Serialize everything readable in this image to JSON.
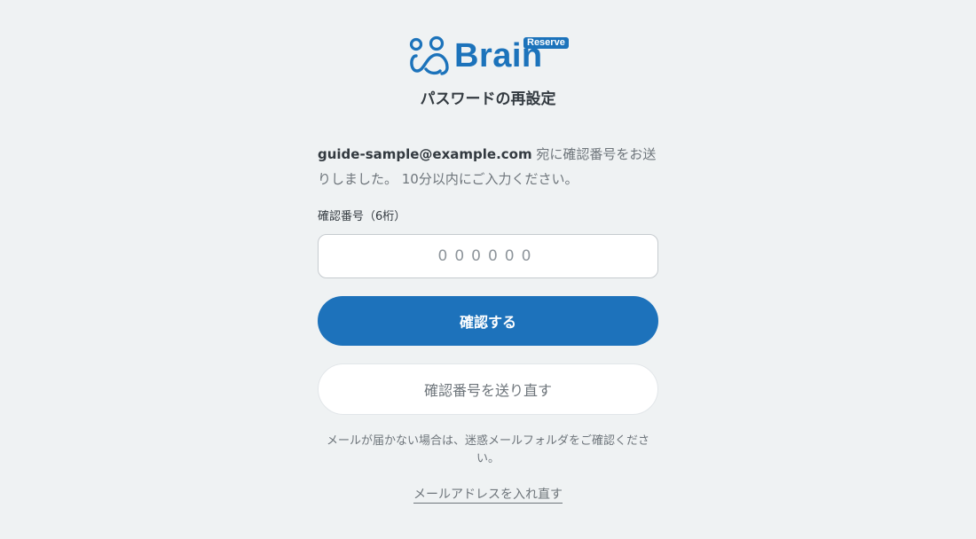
{
  "logo": {
    "name": "Brain",
    "badge": "Reserve",
    "icon": "brain-logo-icon",
    "brand_color": "#1c73bb"
  },
  "header": {
    "title": "パスワードの再設定"
  },
  "message": {
    "email": "guide-sample@example.com",
    "text": " 宛に確認番号をお送りしました。 10分以内にご入力ください。"
  },
  "code_field": {
    "label": "確認番号（6桁）",
    "placeholder": "000000",
    "value": ""
  },
  "buttons": {
    "confirm": "確認する",
    "resend": "確認番号を送り直す"
  },
  "note": "メールが届かない場合は、迷惑メールフォルダをご確認ください。",
  "links": {
    "reenter_email": "メールアドレスを入れ直す"
  },
  "colors": {
    "background": "#eff2f3",
    "primary": "#1d72bb",
    "text": "#333a40",
    "muted": "#6e757b"
  }
}
